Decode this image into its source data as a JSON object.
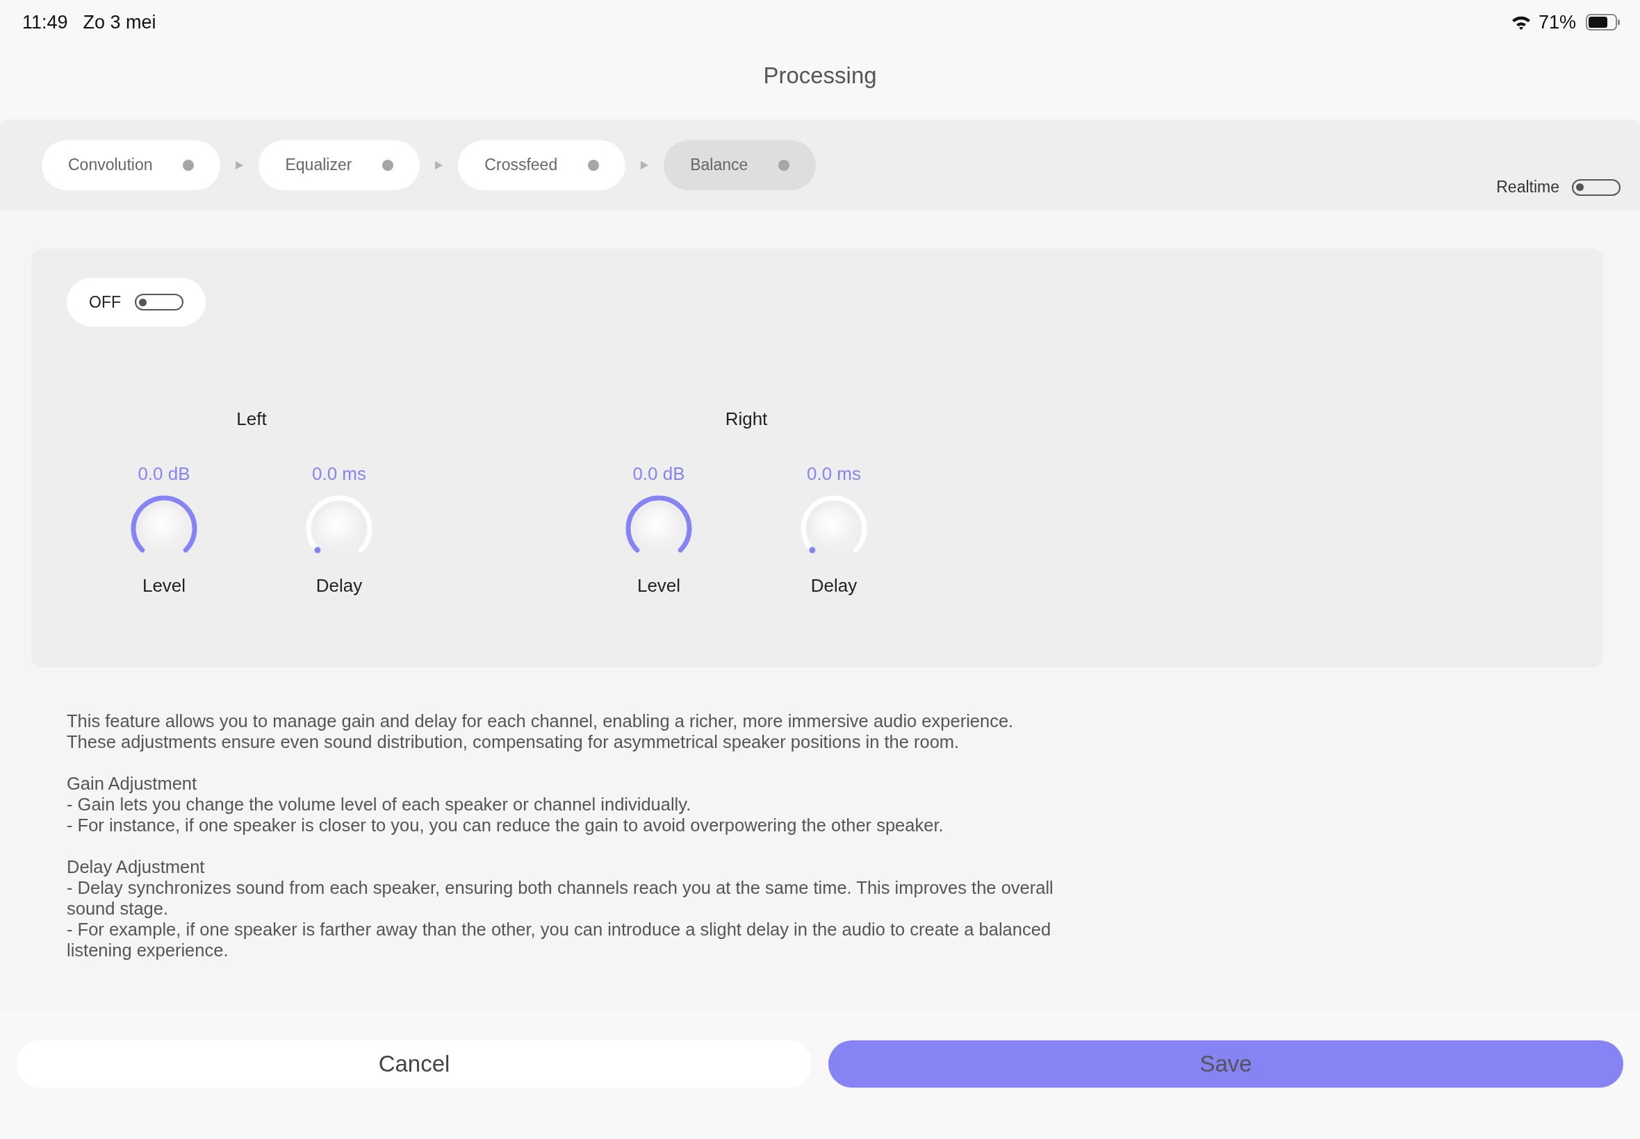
{
  "status_bar": {
    "time": "11:49",
    "date": "Zo 3 mei",
    "battery": "71%"
  },
  "title": "Processing",
  "pipeline": {
    "steps": [
      {
        "label": "Convolution",
        "selected": false
      },
      {
        "label": "Equalizer",
        "selected": false
      },
      {
        "label": "Crossfeed",
        "selected": false
      },
      {
        "label": "Balance",
        "selected": true
      }
    ],
    "realtime": {
      "label": "Realtime",
      "on": false
    }
  },
  "panel": {
    "power": {
      "label": "OFF",
      "on": false
    },
    "channels": [
      {
        "name": "Left",
        "knobs": [
          {
            "value": "0.0 dB",
            "label": "Level"
          },
          {
            "value": "0.0 ms",
            "label": "Delay"
          }
        ]
      },
      {
        "name": "Right",
        "knobs": [
          {
            "value": "0.0 dB",
            "label": "Level"
          },
          {
            "value": "0.0 ms",
            "label": "Delay"
          }
        ]
      }
    ]
  },
  "description": [
    [
      "This feature allows you to manage gain and delay for each channel, enabling a richer, more immersive audio experience.",
      "These adjustments ensure even sound distribution, compensating for asymmetrical speaker positions in the room."
    ],
    [
      "Gain Adjustment",
      "- Gain lets you change the volume level of each speaker or channel individually.",
      "- For instance, if one speaker is closer to you, you can reduce the gain to avoid overpowering the other speaker."
    ],
    [
      "Delay Adjustment",
      "- Delay synchronizes sound from each speaker, ensuring both channels reach you at the same time. This improves the overall sound stage.",
      "- For example, if one speaker is farther away than the other, you can introduce a slight delay in the audio to create a balanced listening experience."
    ]
  ],
  "buttons": [
    {
      "label": "Cancel",
      "kind": "secondary"
    },
    {
      "label": "Save",
      "kind": "primary"
    }
  ]
}
